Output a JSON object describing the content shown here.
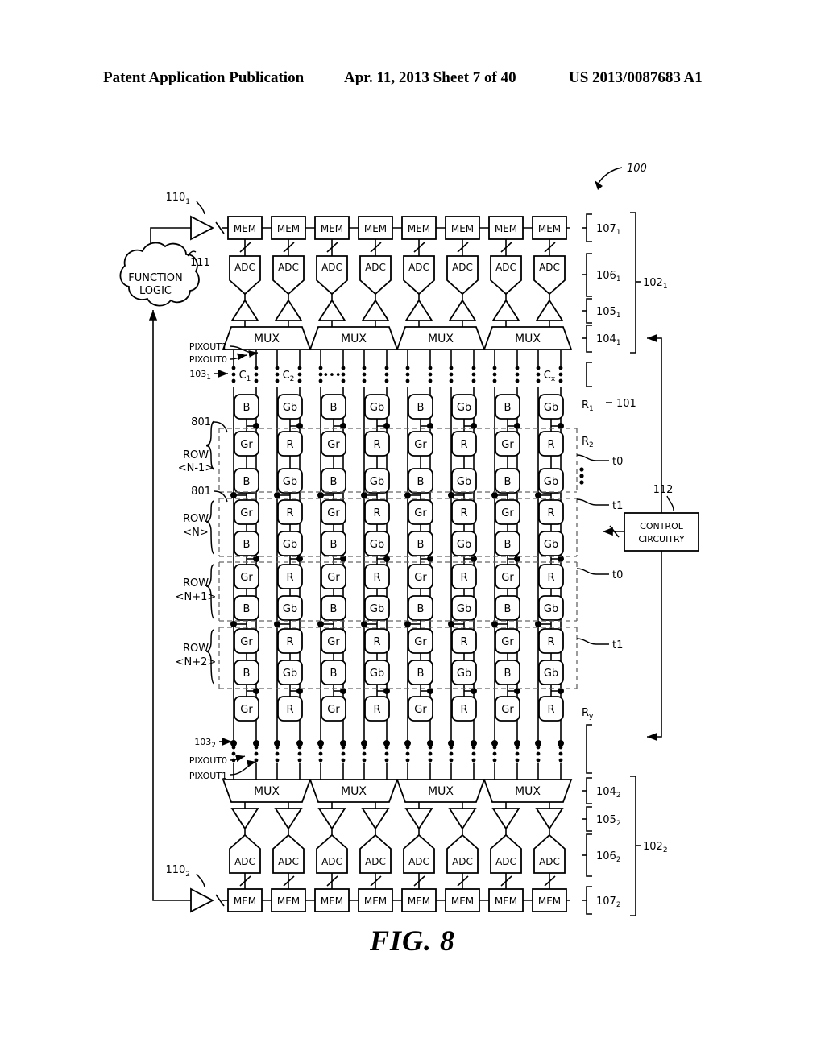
{
  "header": {
    "left": "Patent Application Publication",
    "center": "Apr. 11, 2013  Sheet 7 of 40",
    "right": "US 2013/0087683 A1"
  },
  "figure": {
    "caption": "FIG. 8",
    "top_ref": "100"
  },
  "blocks": {
    "function_logic_line1": "FUNCTION",
    "function_logic_line2": "LOGIC",
    "function_logic_ref": "111",
    "control_line1": "CONTROL",
    "control_line2": "CIRCUITRY",
    "control_ref": "112",
    "mem_label": "MEM",
    "adc_label": "ADC",
    "mux_label": "MUX"
  },
  "amps": {
    "top_ref": "110",
    "top_sub": "1",
    "bottom_ref": "110",
    "bottom_sub": "2"
  },
  "signals": {
    "pixout1": "PIXOUT1",
    "pixout0": "PIXOUT0",
    "top_bus_ref": "103",
    "top_bus_sub": "1",
    "bottom_bus_ref": "103",
    "bottom_bus_sub": "2"
  },
  "brackets_top": [
    {
      "num": "107",
      "sub": "1"
    },
    {
      "num": "106",
      "sub": "1"
    },
    {
      "num": "105",
      "sub": "1"
    },
    {
      "num": "104",
      "sub": "1"
    }
  ],
  "brackets_bottom": [
    {
      "num": "104",
      "sub": "2"
    },
    {
      "num": "105",
      "sub": "2"
    },
    {
      "num": "106",
      "sub": "2"
    },
    {
      "num": "107",
      "sub": "2"
    }
  ],
  "group_top": {
    "num": "102",
    "sub": "1"
  },
  "group_bottom": {
    "num": "102",
    "sub": "2"
  },
  "array": {
    "ref": "101",
    "columns": [
      {
        "name": "C",
        "sub": "1"
      },
      {
        "name": "C",
        "sub": "2"
      },
      {
        "name": "",
        "sub": ""
      },
      {
        "name": "",
        "sub": ""
      },
      {
        "name": "",
        "sub": ""
      },
      {
        "name": "",
        "sub": ""
      },
      {
        "name": "",
        "sub": ""
      },
      {
        "name": "C",
        "sub": "x"
      }
    ],
    "ellipsis_label": "•••",
    "rows": [
      {
        "cells": [
          "B",
          "Gb",
          "B",
          "Gb",
          "B",
          "Gb",
          "B",
          "Gb"
        ]
      },
      {
        "cells": [
          "Gr",
          "R",
          "Gr",
          "R",
          "Gr",
          "R",
          "Gr",
          "R"
        ]
      },
      {
        "cells": [
          "B",
          "Gb",
          "B",
          "Gb",
          "B",
          "Gb",
          "B",
          "Gb"
        ]
      },
      {
        "cells": [
          "Gr",
          "R",
          "Gr",
          "R",
          "Gr",
          "R",
          "Gr",
          "R"
        ]
      },
      {
        "cells": [
          "B",
          "Gb",
          "B",
          "Gb",
          "B",
          "Gb",
          "B",
          "Gb"
        ]
      },
      {
        "cells": [
          "Gr",
          "R",
          "Gr",
          "R",
          "Gr",
          "R",
          "Gr",
          "R"
        ]
      },
      {
        "cells": [
          "B",
          "Gb",
          "B",
          "Gb",
          "B",
          "Gb",
          "B",
          "Gb"
        ]
      },
      {
        "cells": [
          "Gr",
          "R",
          "Gr",
          "R",
          "Gr",
          "R",
          "Gr",
          "R"
        ]
      },
      {
        "cells": [
          "B",
          "Gb",
          "B",
          "Gb",
          "B",
          "Gb",
          "B",
          "Gb"
        ]
      },
      {
        "cells": [
          "Gr",
          "R",
          "Gr",
          "R",
          "Gr",
          "R",
          "Gr",
          "R"
        ]
      }
    ],
    "row_labels": [
      {
        "line1": "ROW",
        "line2": "<N-1>"
      },
      {
        "line1": "ROW",
        "line2": "<N>"
      },
      {
        "line1": "ROW",
        "line2": "<N+1>"
      },
      {
        "line1": "ROW",
        "line2": "<N+2>"
      }
    ],
    "callouts": [
      "801",
      "801"
    ],
    "row_refs": [
      {
        "name": "R",
        "sub": "1"
      },
      {
        "name": "R",
        "sub": "2"
      },
      {
        "name": "R",
        "sub": "y"
      }
    ],
    "timing": [
      "t0",
      "t1",
      "t0",
      "t1"
    ]
  }
}
